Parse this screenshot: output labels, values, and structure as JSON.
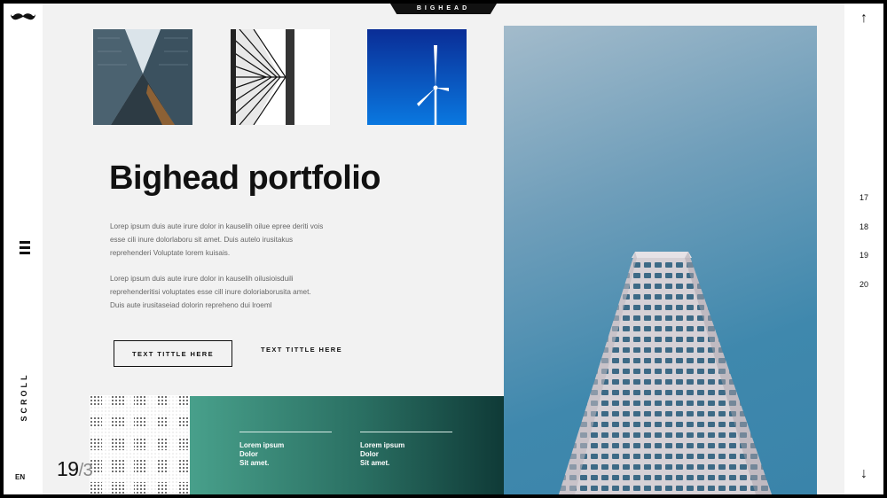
{
  "brand": {
    "name": "BIGHEAD"
  },
  "navigation": {
    "scroll_label": "SCROLL",
    "language": "EN",
    "pages": [
      "17",
      "18",
      "19",
      "20"
    ]
  },
  "hero": {
    "title": "Bighead portfolio",
    "paragraph_1": "Lorep ipsum duis aute irure dolor in kauselih oilue epree deriti vois esse cili inure dolorlaboru sit amet. Duis autelo irusitakus reprehenderi Voluptate lorem kuisais.",
    "paragraph_2": "Lorep ipsum duis aute irure dolor in kauselih oilusioisduili reprehenderitisi voluptates esse cill inure doloriaborusita amet. Duis aute irusitaseiad dolorin repreheno dui lroeml"
  },
  "buttons": {
    "primary_label": "TEXT TITTLE HERE",
    "secondary_label": "TEXT TITTLE HERE"
  },
  "green_panel": {
    "col1": [
      "Lorem ipsum",
      "Dolor",
      "Sit amet."
    ],
    "col2": [
      "Lorem ipsum",
      "Dolor",
      "Sit amet."
    ]
  },
  "page_indicator": {
    "current": "19",
    "separator": "/",
    "total": "3"
  },
  "colors": {
    "accent_green_start": "#48a08b",
    "accent_green_end": "#0f3a37",
    "sky_blue": "#3f88ad",
    "text_dark": "#111111"
  },
  "icons": {
    "logo": "mustache-icon",
    "menu": "hamburger-icon",
    "up": "arrow-up-icon",
    "down": "arrow-down-icon"
  }
}
